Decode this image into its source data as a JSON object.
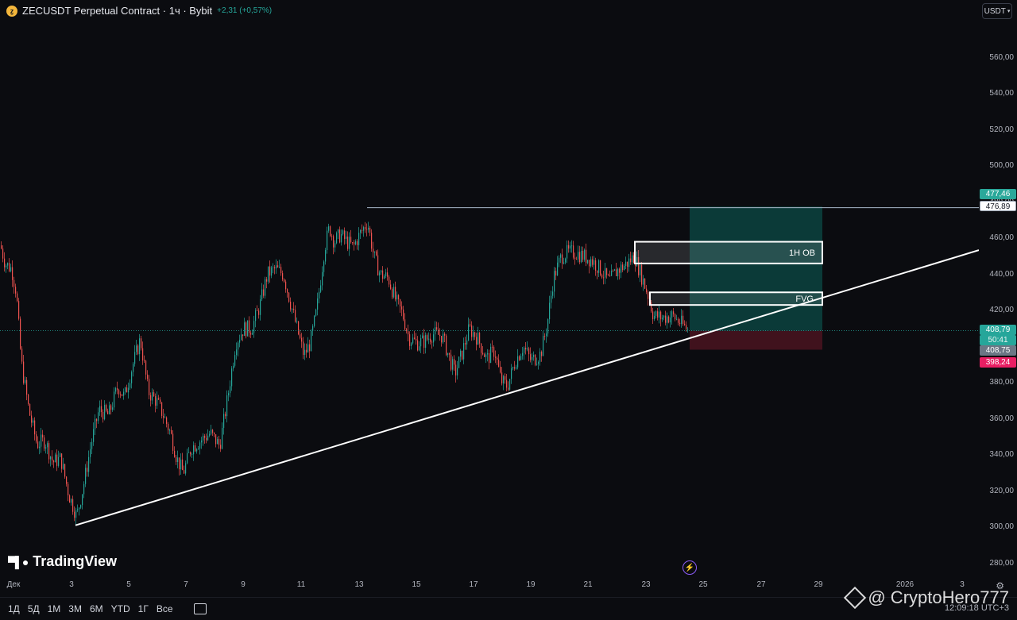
{
  "header": {
    "coin_letter": "ẕ",
    "title": "ZECUSDT Perpetual Contract · 1ч · Bybit",
    "change": "+2,31 (+0,57%)"
  },
  "currency": "USDT",
  "tags": {
    "target_price": "477,46",
    "line_price": "476,89",
    "current_price": "408,79",
    "countdown": "50:41",
    "entry_price": "408,75",
    "stop_price": "398,24"
  },
  "zones": {
    "ob_label": "1H OB",
    "fvg_label": "FVG"
  },
  "time_axis": [
    "Дек",
    "3",
    "5",
    "7",
    "9",
    "11",
    "13",
    "15",
    "17",
    "19",
    "21",
    "23",
    "25",
    "27",
    "29",
    "2026",
    "3"
  ],
  "ranges": [
    "1Д",
    "5Д",
    "1М",
    "3М",
    "6М",
    "YTD",
    "1Г",
    "Все"
  ],
  "logo": "TradingView",
  "clock": "12:09:18 UTC+3",
  "watermark": "@ CryptoHero777",
  "colors": {
    "up": "#26a69a",
    "down": "#ef5350",
    "target_zone": "#0c4a45",
    "stop_zone": "#4a1420"
  },
  "chart_data": {
    "type": "candlestick",
    "yticks": [
      "560,00",
      "540,00",
      "520,00",
      "500,00",
      "480,00",
      "460,00",
      "440,00",
      "420,00",
      "400,00",
      "380,00",
      "360,00",
      "340,00",
      "320,00",
      "300,00",
      "280,00"
    ],
    "ylim": [
      276,
      580
    ],
    "resistance_price": 476.89,
    "trendline": {
      "from": {
        "date": "Дек 3",
        "price": 301
      },
      "to": {
        "date": "29",
        "price": 449
      }
    },
    "position": {
      "entry": 408.75,
      "target": 477.46,
      "stop": 398.24
    },
    "path": [
      [
        0,
        456
      ],
      [
        6,
        446
      ],
      [
        14,
        443
      ],
      [
        20,
        430
      ],
      [
        26,
        392
      ],
      [
        36,
        364
      ],
      [
        46,
        346
      ],
      [
        56,
        348
      ],
      [
        66,
        336
      ],
      [
        76,
        338
      ],
      [
        86,
        318
      ],
      [
        96,
        306
      ],
      [
        104,
        322
      ],
      [
        114,
        346
      ],
      [
        124,
        365
      ],
      [
        136,
        362
      ],
      [
        148,
        378
      ],
      [
        156,
        372
      ],
      [
        166,
        389
      ],
      [
        176,
        404
      ],
      [
        186,
        375
      ],
      [
        196,
        370
      ],
      [
        204,
        363
      ],
      [
        214,
        352
      ],
      [
        222,
        338
      ],
      [
        230,
        330
      ],
      [
        240,
        344
      ],
      [
        252,
        348
      ],
      [
        264,
        352
      ],
      [
        276,
        345
      ],
      [
        286,
        372
      ],
      [
        296,
        402
      ],
      [
        306,
        410
      ],
      [
        316,
        410
      ],
      [
        326,
        422
      ],
      [
        336,
        440
      ],
      [
        346,
        443
      ],
      [
        356,
        440
      ],
      [
        364,
        426
      ],
      [
        372,
        412
      ],
      [
        382,
        395
      ],
      [
        390,
        402
      ],
      [
        398,
        420
      ],
      [
        408,
        455
      ],
      [
        414,
        466
      ],
      [
        420,
        458
      ],
      [
        428,
        462
      ],
      [
        436,
        458
      ],
      [
        444,
        455
      ],
      [
        452,
        462
      ],
      [
        462,
        469
      ],
      [
        470,
        450
      ],
      [
        478,
        440
      ],
      [
        488,
        438
      ],
      [
        498,
        425
      ],
      [
        506,
        418
      ],
      [
        514,
        405
      ],
      [
        524,
        402
      ],
      [
        534,
        403
      ],
      [
        544,
        407
      ],
      [
        556,
        406
      ],
      [
        564,
        395
      ],
      [
        572,
        385
      ],
      [
        580,
        395
      ],
      [
        590,
        410
      ],
      [
        600,
        405
      ],
      [
        612,
        393
      ],
      [
        622,
        398
      ],
      [
        630,
        381
      ],
      [
        638,
        378
      ],
      [
        648,
        392
      ],
      [
        658,
        400
      ],
      [
        668,
        392
      ],
      [
        680,
        396
      ],
      [
        688,
        412
      ],
      [
        696,
        438
      ],
      [
        706,
        450
      ],
      [
        714,
        452
      ],
      [
        724,
        452
      ],
      [
        734,
        450
      ],
      [
        744,
        448
      ],
      [
        756,
        442
      ],
      [
        766,
        436
      ],
      [
        776,
        442
      ],
      [
        786,
        445
      ],
      [
        798,
        450
      ],
      [
        806,
        440
      ],
      [
        814,
        430
      ],
      [
        822,
        417
      ],
      [
        834,
        416
      ],
      [
        846,
        417
      ],
      [
        856,
        413
      ],
      [
        866,
        409
      ]
    ]
  }
}
